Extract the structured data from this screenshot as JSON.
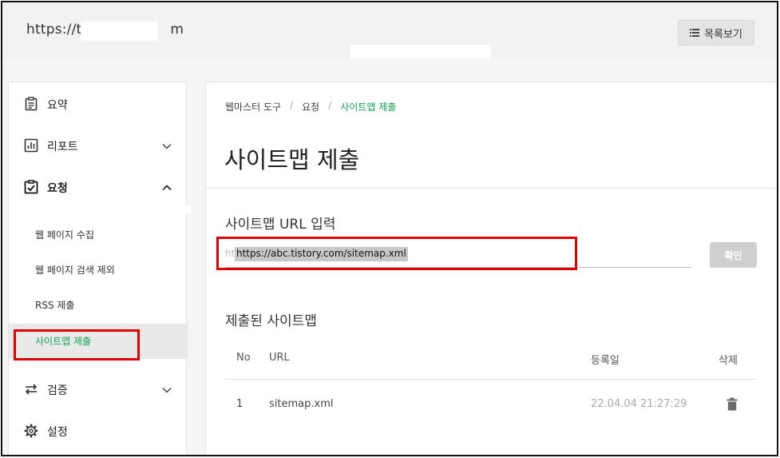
{
  "header": {
    "site_url_prefix": "https://t",
    "site_url_suffix": "m",
    "list_button_label": "목록보기"
  },
  "sidebar": {
    "items": [
      {
        "label": "요약",
        "icon": "clipboard-list-icon"
      },
      {
        "label": "리포트",
        "icon": "bar-chart-icon",
        "expanded": false
      },
      {
        "label": "요청",
        "icon": "clipboard-check-icon",
        "expanded": true
      },
      {
        "label": "검증",
        "icon": "swap-arrows-icon",
        "expanded": false
      },
      {
        "label": "설정",
        "icon": "gear-icon"
      }
    ],
    "sub_items": [
      {
        "label": "웹 페이지 수집"
      },
      {
        "label": "웹 페이지 검색 제외"
      },
      {
        "label": "RSS 제출"
      },
      {
        "label": "사이트맵 제출",
        "active": true
      }
    ]
  },
  "main": {
    "breadcrumb": [
      "웹마스터 도구",
      "요청",
      "사이트맵 제출"
    ],
    "breadcrumb_separator": "/",
    "page_title": "사이트맵 제출",
    "url_section_title": "사이트맵 URL 입력",
    "url_input_value": "https://abc.tistory.com/sitemap.xml",
    "url_placeholder_fragment": "ht",
    "confirm_label": "확인",
    "submitted_title": "제출된 사이트맵",
    "table": {
      "headers": [
        "No",
        "URL",
        "등록일",
        "삭제"
      ],
      "rows": [
        {
          "no": "1",
          "url": "sitemap.xml",
          "date": "22.04.04 21:27:29"
        }
      ]
    }
  },
  "colors": {
    "accent_green": "#0fa551",
    "highlight_red": "#e10000",
    "button_disabled": "#cfcfcf"
  }
}
